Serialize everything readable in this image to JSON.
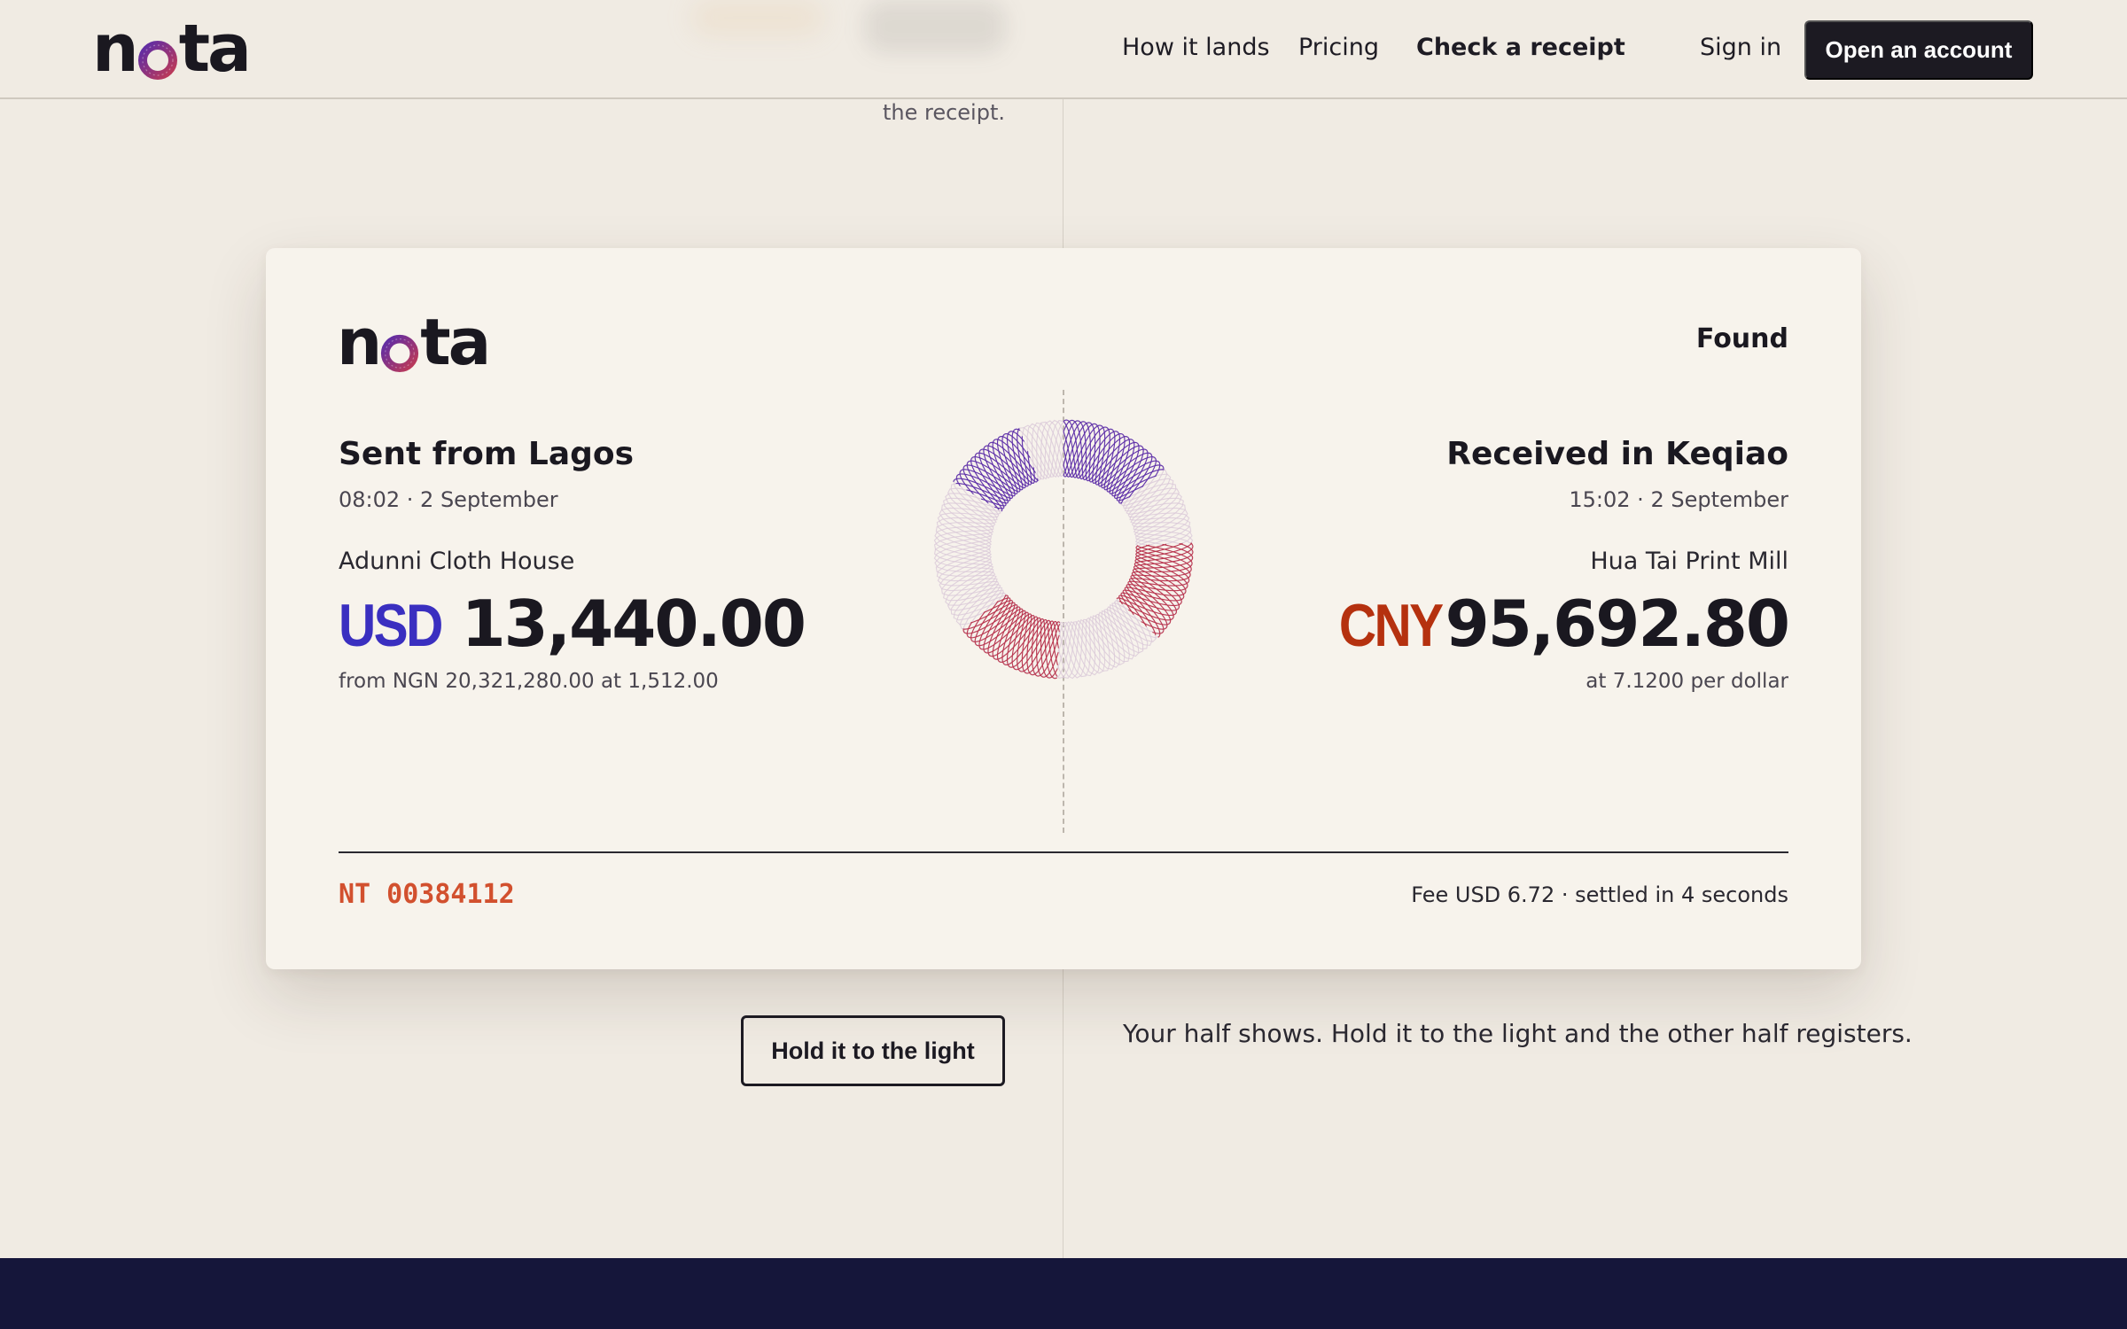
{
  "brand": {
    "logo_text_a": "n",
    "logo_text_o": "o",
    "logo_text_b": "ta"
  },
  "header": {
    "nav": [
      {
        "label": "How it lands"
      },
      {
        "label": "Pricing"
      },
      {
        "label": "Check a receipt"
      }
    ],
    "sign_in": "Sign in",
    "cta": "Open an account"
  },
  "section": {
    "partial_caption": "the receipt."
  },
  "receipt": {
    "status": "Found",
    "sender": {
      "title": "Sent from Lagos",
      "time": "08:02 · 2 September",
      "party": "Adunni Cloth House",
      "currency": "USD",
      "amount": "13,440.00",
      "note": "from NGN 20,321,280.00 at 1,512.00"
    },
    "receiver": {
      "title": "Received in Keqiao",
      "time": "15:02 · 2 September",
      "party": "Hua Tai Print Mill",
      "currency": "CNY",
      "amount": "95,692.80",
      "note": "at 7.1200 per dollar"
    },
    "reference": "NT 00384112",
    "fee_line": "Fee USD 6.72 · settled in 4 seconds"
  },
  "actions": {
    "hold_button": "Hold it to the light",
    "hint": "Your half shows. Hold it to the light and the other half registers."
  },
  "colors": {
    "usd": "#3a2fc0",
    "cny": "#b5310f",
    "reference": "#d2502e",
    "ring_purple": "#5b2ca8",
    "ring_red": "#b8324a",
    "ring_faint": "#d9c8d8",
    "footer": "#15163a"
  },
  "icons": {
    "ring": "guilloche-ring-icon"
  }
}
